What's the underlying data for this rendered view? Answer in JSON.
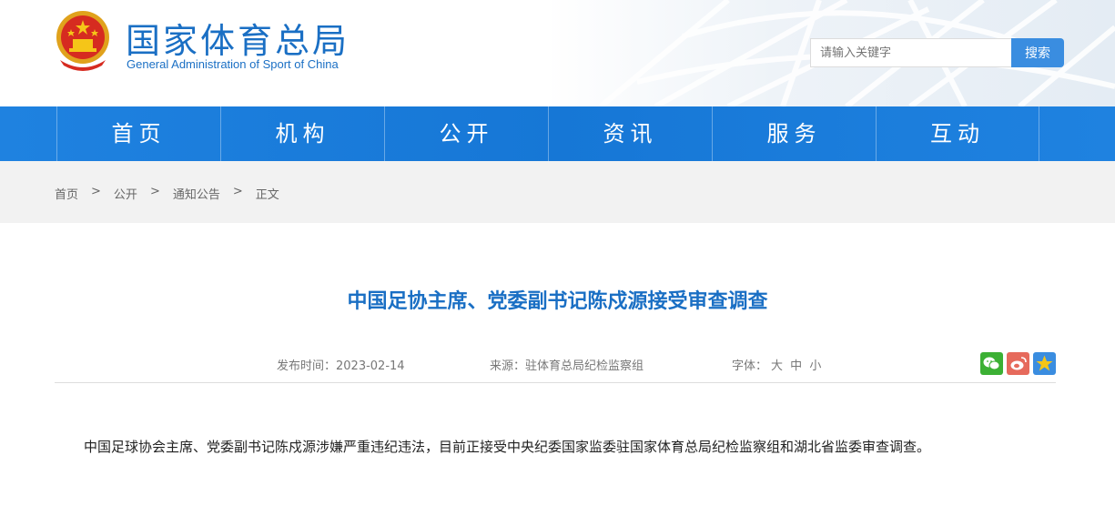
{
  "header": {
    "title_cn": "国家体育总局",
    "title_en": "General Administration of Sport of China",
    "search_placeholder": "请输入关键字",
    "search_button": "搜索"
  },
  "nav": {
    "items": [
      {
        "label": "首页"
      },
      {
        "label": "机构"
      },
      {
        "label": "公开"
      },
      {
        "label": "资讯"
      },
      {
        "label": "服务"
      },
      {
        "label": "互动"
      }
    ]
  },
  "breadcrumb": {
    "items": [
      "首页",
      "公开",
      "通知公告",
      "正文"
    ],
    "separator": ">"
  },
  "article": {
    "title": "中国足协主席、党委副书记陈戍源接受审查调查",
    "publish_time": "发布时间：2023-02-14",
    "source": "来源：驻体育总局纪检监察组",
    "font_label": "字体：",
    "font_sizes": [
      "大",
      "中",
      "小"
    ],
    "body": "中国足球协会主席、党委副书记陈戍源涉嫌严重违纪违法，目前正接受中央纪委国家监委驻国家体育总局纪检监察组和湖北省监委审查调查。"
  },
  "share": {
    "icons": [
      "wechat-icon",
      "weibo-icon",
      "favorite-star-icon"
    ]
  },
  "colors": {
    "brand_blue": "#1a6fc4",
    "nav_blue": "#1677d6",
    "search_button": "#3a8de0"
  }
}
